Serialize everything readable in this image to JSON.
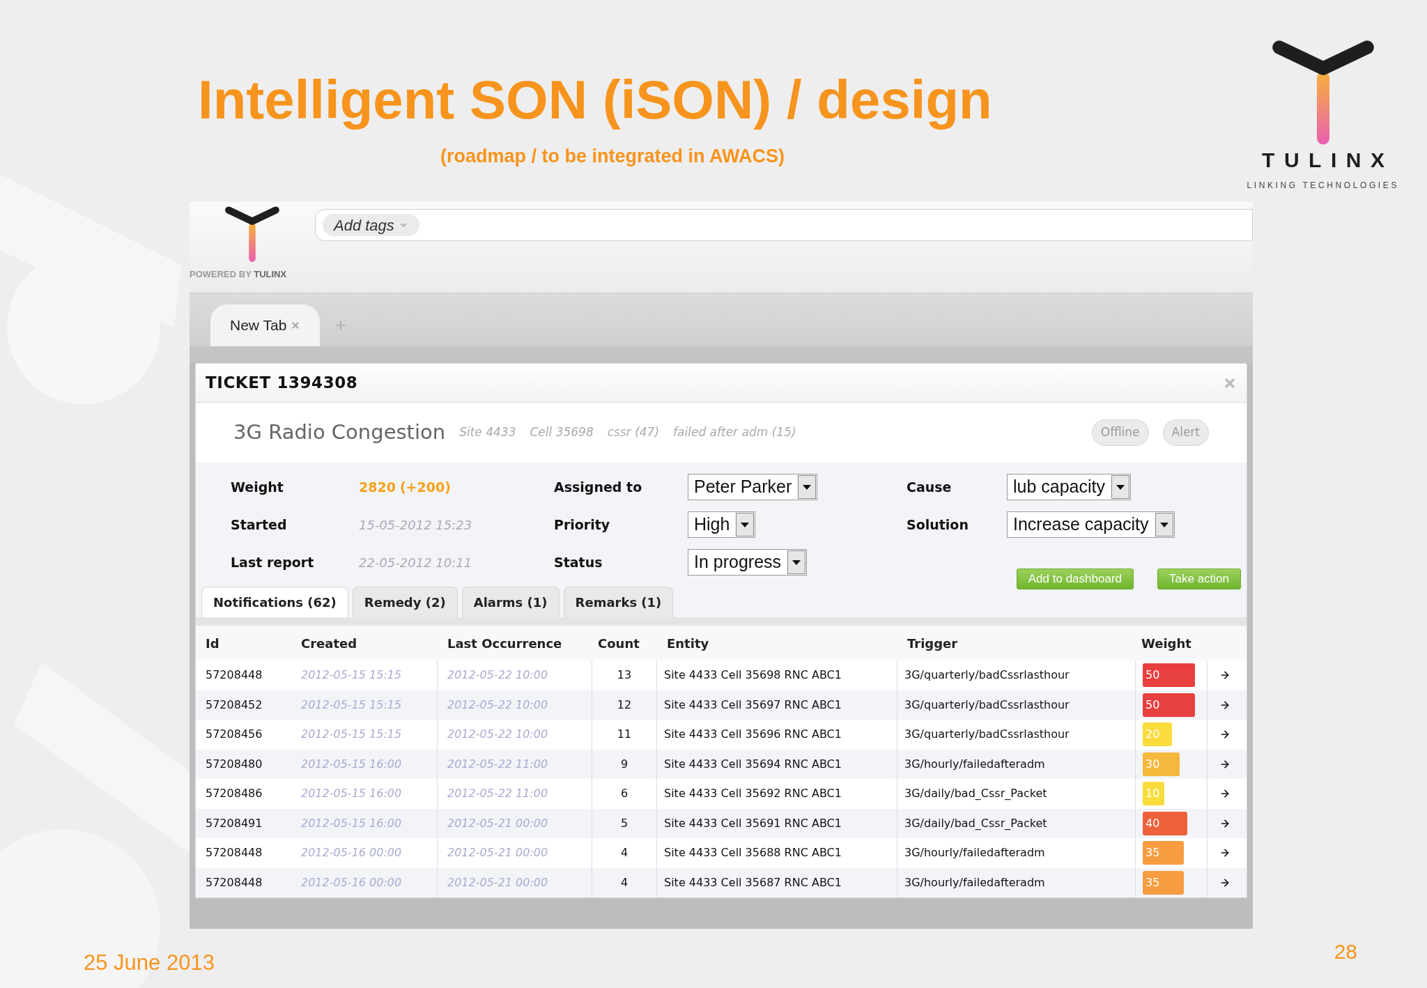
{
  "slide": {
    "title": "Intelligent SON (iSON) / design",
    "subtitle": "(roadmap / to be integrated in AWACS)",
    "brand": {
      "name": "TULINX",
      "tagline": "LINKING TECHNOLOGIES"
    },
    "date": "25 June 2013",
    "page_number": "28"
  },
  "app": {
    "powered_by": "POWERED BY **TULINX**",
    "tag_button": "Add tags",
    "tabs": [
      {
        "label": "New Tab",
        "selected": true
      }
    ],
    "ticket": {
      "title": "TICKET 1394308",
      "subject": "3G Radio Congestion",
      "meta": [
        "Site 4433",
        "Cell 35698",
        "cssr (47)",
        "failed after adm (15)"
      ],
      "badges": [
        "Offline",
        "Alert"
      ],
      "field_columns": [
        [
          {
            "kind": "weight",
            "label": "Weight",
            "value": "2820",
            "delta": "(+200)"
          },
          {
            "kind": "date",
            "label": "Started",
            "value": "15-05-2012 15:23"
          },
          {
            "kind": "date",
            "label": "Last report",
            "value": "22-05-2012 10:11"
          }
        ],
        [
          {
            "kind": "select",
            "label": "Assigned to",
            "value": "Peter Parker"
          },
          {
            "kind": "select",
            "label": "Priority",
            "value": "High"
          },
          {
            "kind": "select",
            "label": "Status",
            "value": "In progress"
          }
        ],
        [
          {
            "kind": "select",
            "label": "Cause",
            "value": "lub capacity"
          },
          {
            "kind": "select",
            "label": "Solution",
            "value": "Increase capacity"
          }
        ]
      ],
      "actions": [
        "Add to dashboard",
        "Take action"
      ],
      "subtabs": [
        {
          "label": "Notifications (62)",
          "selected": true
        },
        {
          "label": "Remedy (2)",
          "selected": false
        },
        {
          "label": "Alarms (1)",
          "selected": false
        },
        {
          "label": "Remarks (1)",
          "selected": false
        }
      ],
      "table": {
        "columns": [
          "Id",
          "Created",
          "Last Occurrence",
          "Count",
          "Entity",
          "Trigger",
          "Weight"
        ],
        "rows": [
          {
            "id": "57208448",
            "created": "2012-05-15 15:15",
            "last_occurrence": "2012-05-22 10:00",
            "count": "13",
            "entity": "Site 4433 Cell 35698 RNC ABC1",
            "trigger": "3G/quarterly/badCssrlasthour",
            "weight": {
              "value": "50",
              "color": "#e8403f"
            }
          },
          {
            "id": "57208452",
            "created": "2012-05-15 15:15",
            "last_occurrence": "2012-05-22 10:00",
            "count": "12",
            "entity": "Site 4433 Cell 35697 RNC ABC1",
            "trigger": "3G/quarterly/badCssrlasthour",
            "weight": {
              "value": "50",
              "color": "#e8403f"
            }
          },
          {
            "id": "57208456",
            "created": "2012-05-15 15:15",
            "last_occurrence": "2012-05-22 10:00",
            "count": "11",
            "entity": "Site 4433 Cell 35696 RNC ABC1",
            "trigger": "3G/quarterly/badCssrlasthour",
            "weight": {
              "value": "20",
              "color": "#f9dc3c"
            }
          },
          {
            "id": "57208480",
            "created": "2012-05-15 16:00",
            "last_occurrence": "2012-05-22 11:00",
            "count": "9",
            "entity": "Site 4433 Cell 35694 RNC ABC1",
            "trigger": "3G/hourly/failedafteradm",
            "weight": {
              "value": "30",
              "color": "#f5b73c"
            }
          },
          {
            "id": "57208486",
            "created": "2012-05-15 16:00",
            "last_occurrence": "2012-05-22 11:00",
            "count": "6",
            "entity": "Site 4433 Cell 35692 RNC ABC1",
            "trigger": "3G/daily/bad_Cssr_Packet",
            "weight": {
              "value": "10",
              "color": "#f9dc3c"
            }
          },
          {
            "id": "57208491",
            "created": "2012-05-15 16:00",
            "last_occurrence": "2012-05-21 00:00",
            "count": "5",
            "entity": "Site 4433 Cell 35691 RNC ABC1",
            "trigger": "3G/daily/bad_Cssr_Packet",
            "weight": {
              "value": "40",
              "color": "#ee6039"
            }
          },
          {
            "id": "57208448",
            "created": "2012-05-16 00:00",
            "last_occurrence": "2012-05-21 00:00",
            "count": "4",
            "entity": "Site 4433 Cell 35688 RNC ABC1",
            "trigger": "3G/hourly/failedafteradm",
            "weight": {
              "value": "35",
              "color": "#f79c40"
            }
          },
          {
            "id": "57208448",
            "created": "2012-05-16 00:00",
            "last_occurrence": "2012-05-21 00:00",
            "count": "4",
            "entity": "Site 4433 Cell 35687 RNC ABC1",
            "trigger": "3G/hourly/failedafteradm",
            "weight": {
              "value": "35",
              "color": "#f79c40"
            }
          }
        ]
      }
    }
  }
}
